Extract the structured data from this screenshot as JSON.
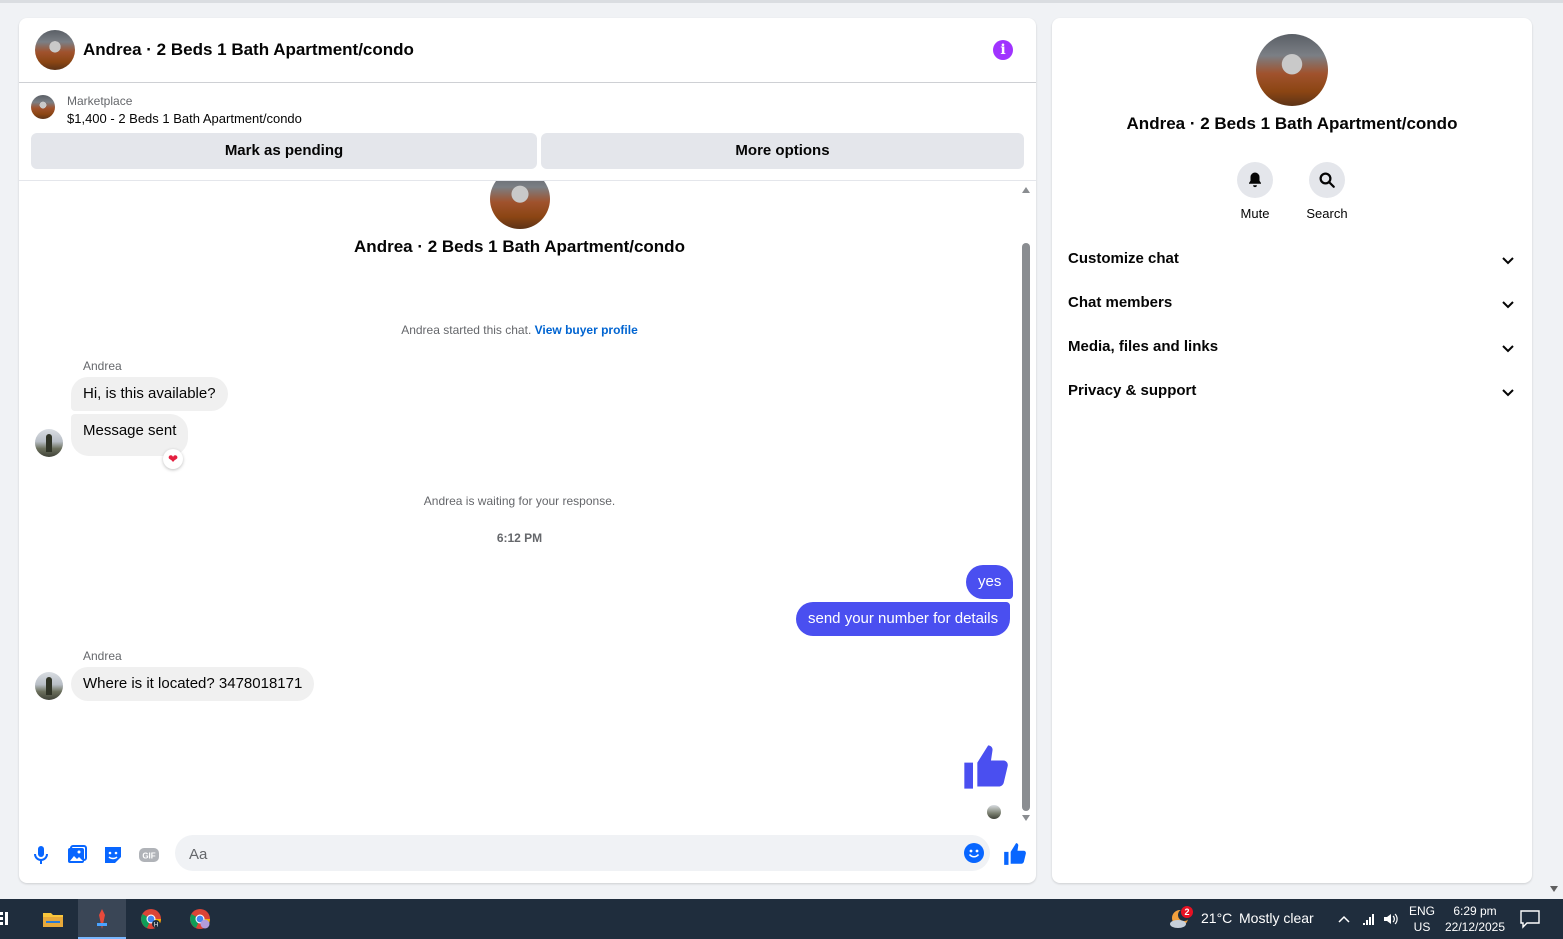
{
  "chat": {
    "title": "Andrea · 2 Beds 1 Bath Apartment/condo",
    "listing": {
      "kicker": "Marketplace",
      "price_title": "$1,400 - 2 Beds 1 Bath Apartment/condo"
    },
    "actions": {
      "pending": "Mark as pending",
      "more": "More options"
    },
    "intro_title": "Andrea · 2 Beds 1 Bath Apartment/condo",
    "started_text": "Andrea started this chat.",
    "view_profile": "View buyer profile",
    "waiting_text": "Andrea is waiting for your response.",
    "timestamp": "6:12 PM",
    "messages": [
      {
        "sender": "Andrea",
        "text": "Hi, is this available?",
        "direction": "in"
      },
      {
        "sender": "Andrea",
        "text": "Message sent",
        "direction": "in",
        "reaction": "heart"
      },
      {
        "sender": "me",
        "text": "yes",
        "direction": "out"
      },
      {
        "sender": "me",
        "text": "send your number for details",
        "direction": "out"
      },
      {
        "sender": "Andrea",
        "text": "Where is it located? 3478018171",
        "direction": "in"
      }
    ],
    "sender_name": "Andrea",
    "composer_placeholder": "Aa",
    "accent_color": "#4a4ff0"
  },
  "info_panel": {
    "title": "Andrea · 2 Beds 1 Bath Apartment/condo",
    "quick_actions": {
      "mute": "Mute",
      "search": "Search"
    },
    "sections": [
      "Customize chat",
      "Chat members",
      "Media, files and links",
      "Privacy & support"
    ]
  },
  "taskbar": {
    "weather_badge": "2",
    "temperature": "21°C",
    "condition": "Mostly clear",
    "lang_top": "ENG",
    "lang_bottom": "US",
    "time": "6:29 pm",
    "date": "22/12/2025",
    "apps": [
      "file-explorer-icon",
      "tool-icon",
      "chrome-icon",
      "chrome-profile-icon"
    ]
  }
}
